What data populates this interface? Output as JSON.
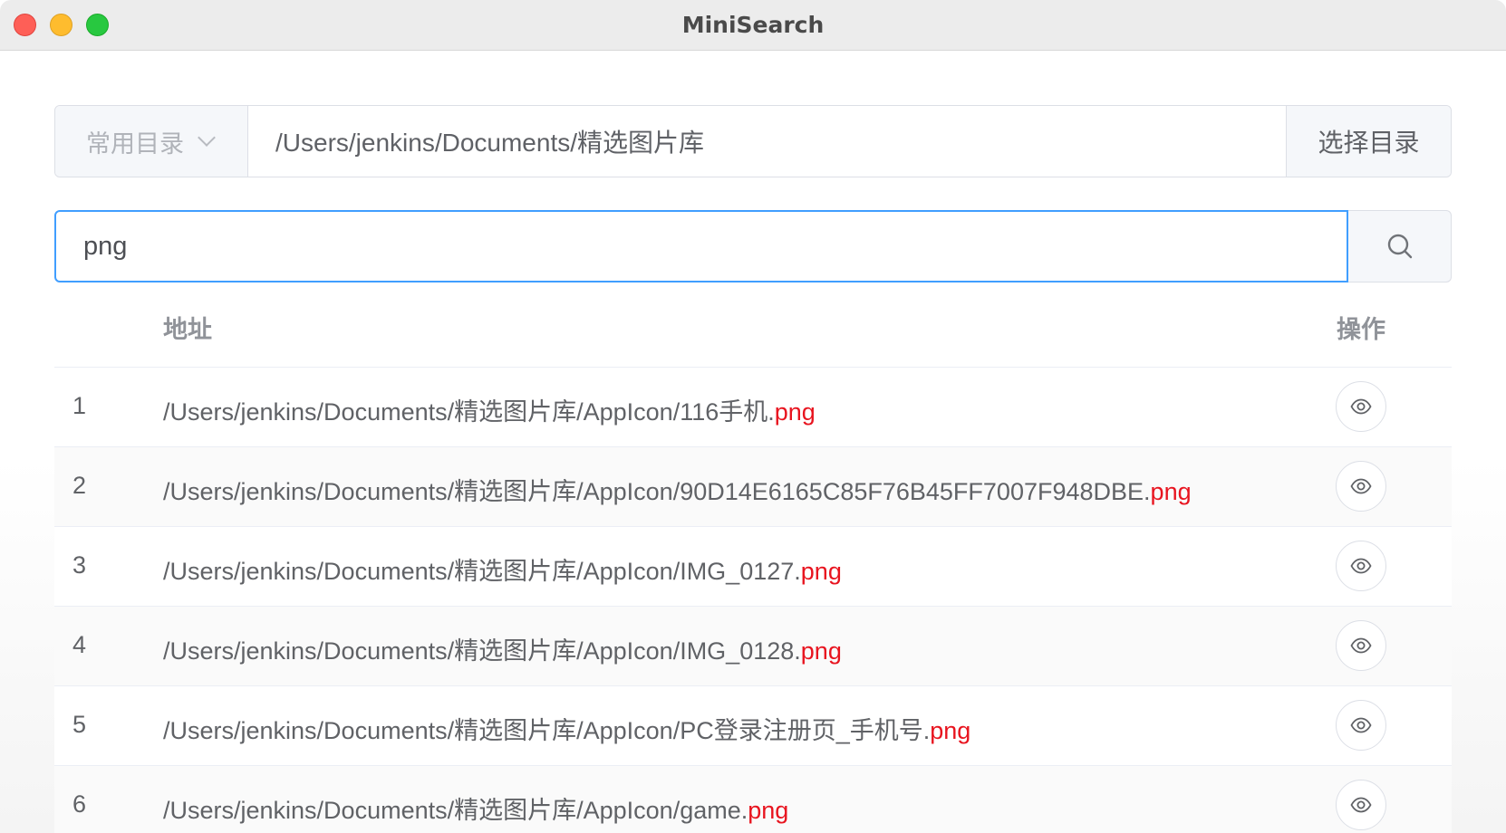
{
  "window": {
    "title": "MiniSearch"
  },
  "directory": {
    "dropdown_label": "常用目录",
    "path": "/Users/jenkins/Documents/精选图片库",
    "choose_button": "选择目录"
  },
  "search": {
    "value": "png"
  },
  "table": {
    "headers": {
      "address": "地址",
      "action": "操作"
    },
    "rows": [
      {
        "index": "1",
        "prefix": "/Users/jenkins/Documents/精选图片库/AppIcon/116手机.",
        "match": "png"
      },
      {
        "index": "2",
        "prefix": "/Users/jenkins/Documents/精选图片库/AppIcon/90D14E6165C85F76B45FF7007F948DBE.",
        "match": "png"
      },
      {
        "index": "3",
        "prefix": "/Users/jenkins/Documents/精选图片库/AppIcon/IMG_0127.",
        "match": "png"
      },
      {
        "index": "4",
        "prefix": "/Users/jenkins/Documents/精选图片库/AppIcon/IMG_0128.",
        "match": "png"
      },
      {
        "index": "5",
        "prefix": "/Users/jenkins/Documents/精选图片库/AppIcon/PC登录注册页_手机号.",
        "match": "png"
      },
      {
        "index": "6",
        "prefix": "/Users/jenkins/Documents/精选图片库/AppIcon/game.",
        "match": "png"
      }
    ]
  },
  "colors": {
    "accent": "#409eff",
    "highlight": "#e8141f"
  },
  "icons": {
    "search": "search-icon",
    "preview": "eye-icon",
    "dropdown": "chevron-down-icon"
  }
}
